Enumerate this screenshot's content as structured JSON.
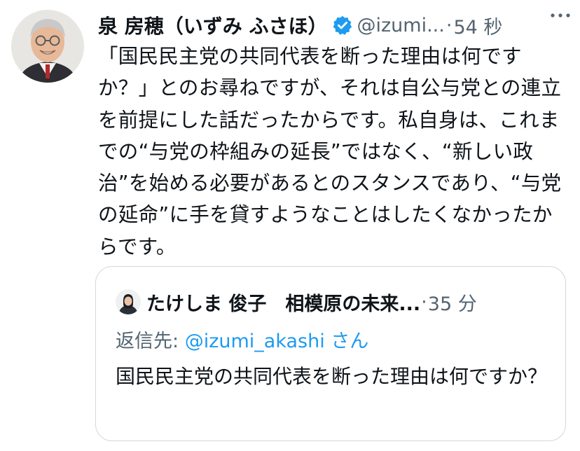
{
  "tweet": {
    "author_name": "泉 房穂（いずみ ふさほ）",
    "handle": "@izumi...",
    "separator": "·",
    "time": "54 秒",
    "verified_icon": "verified-badge-icon",
    "more_icon": "more-dots-icon",
    "text": "「国民民主党の共同代表を断った理由は何ですか？」とのお尋ねですが、それは自公与党との連立を前提にした話だったからです。私自身は、これまでの“与党の枠組みの延長”ではなく、“新しい政治”を始める必要があるとのスタンスであり、“与党の延命”に手を貸すようなことはしたくなかったからです。"
  },
  "quote": {
    "author_name": "たけしま 俊子　相模原の未来...",
    "separator": "·",
    "time": "35 分",
    "reply_prefix": "返信先: ",
    "reply_handle": "@izumi_akashi",
    "reply_suffix": " さん",
    "text": "国民民主党の共同代表を断った理由は何ですか？"
  },
  "colors": {
    "text": "#0f1419",
    "secondary": "#536471",
    "link": "#1d9bf0",
    "border": "#cfd9de",
    "verified": "#1d9bf0"
  }
}
